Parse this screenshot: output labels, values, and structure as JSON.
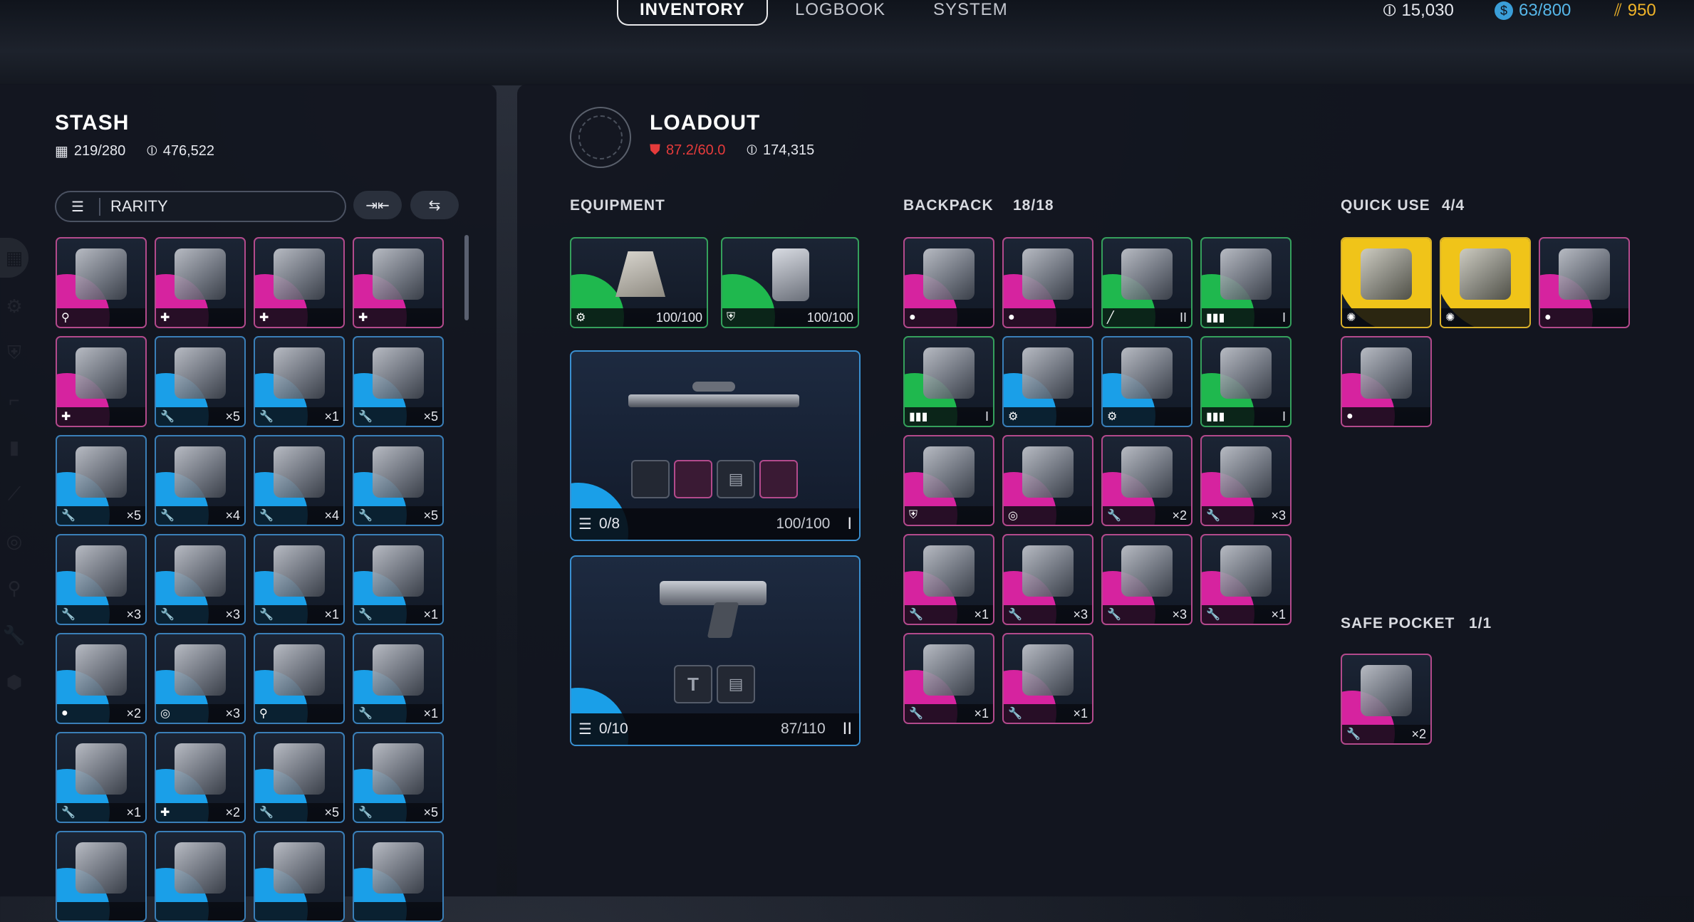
{
  "nav": {
    "tabs": [
      {
        "label": "INVENTORY"
      },
      {
        "label": "LOGBOOK"
      },
      {
        "label": "SYSTEM"
      }
    ],
    "currencies": [
      {
        "icon": "coin-icon",
        "value": "15,030",
        "color": "#ffffff"
      },
      {
        "icon": "token-icon",
        "value": "63/800",
        "color": "#56b6e8"
      },
      {
        "icon": "crown-icon",
        "value": "950",
        "color": "#f0b429"
      }
    ]
  },
  "stash": {
    "title": "STASH",
    "capacity": "219/280",
    "value": "476,522",
    "filter": "RARITY",
    "items": [
      {
        "r": "mag",
        "icon": "key-icon",
        "qty": ""
      },
      {
        "r": "mag",
        "icon": "plus-icon",
        "qty": ""
      },
      {
        "r": "mag",
        "icon": "plus-icon",
        "qty": ""
      },
      {
        "r": "mag",
        "icon": "plus-icon",
        "qty": ""
      },
      {
        "r": "mag",
        "icon": "plus-icon",
        "qty": ""
      },
      {
        "r": "blu",
        "icon": "wrench-icon",
        "qty": "×5"
      },
      {
        "r": "blu",
        "icon": "wrench-icon",
        "qty": "×1"
      },
      {
        "r": "blu",
        "icon": "wrench-icon",
        "qty": "×5"
      },
      {
        "r": "blu",
        "icon": "wrench-icon",
        "qty": "×5"
      },
      {
        "r": "blu",
        "icon": "wrench-icon",
        "qty": "×4"
      },
      {
        "r": "blu",
        "icon": "wrench-icon",
        "qty": "×4"
      },
      {
        "r": "blu",
        "icon": "wrench-icon",
        "qty": "×5"
      },
      {
        "r": "blu",
        "icon": "wrench-icon",
        "qty": "×3"
      },
      {
        "r": "blu",
        "icon": "wrench-icon",
        "qty": "×3"
      },
      {
        "r": "blu",
        "icon": "wrench-icon",
        "qty": "×1"
      },
      {
        "r": "blu",
        "icon": "wrench-icon",
        "qty": "×1"
      },
      {
        "r": "blu",
        "icon": "grenade-icon",
        "qty": "×2"
      },
      {
        "r": "blu",
        "icon": "target-icon",
        "qty": "×3"
      },
      {
        "r": "blu",
        "icon": "key-icon",
        "qty": ""
      },
      {
        "r": "blu",
        "icon": "wrench-icon",
        "qty": "×1"
      },
      {
        "r": "blu",
        "icon": "wrench-icon",
        "qty": "×1"
      },
      {
        "r": "blu",
        "icon": "plus-icon",
        "qty": "×2"
      },
      {
        "r": "blu",
        "icon": "wrench-icon",
        "qty": "×5"
      },
      {
        "r": "blu",
        "icon": "wrench-icon",
        "qty": "×5"
      },
      {
        "r": "blu",
        "icon": "",
        "qty": ""
      },
      {
        "r": "blu",
        "icon": "",
        "qty": ""
      },
      {
        "r": "blu",
        "icon": "",
        "qty": ""
      },
      {
        "r": "blu",
        "icon": "",
        "qty": ""
      }
    ]
  },
  "loadout": {
    "title": "LOADOUT",
    "weight": "87.2/60.0",
    "value": "174,315",
    "equipment_label": "EQUIPMENT",
    "equipment": [
      {
        "r": "grn",
        "icon": "gear-icon",
        "durability": "100/100"
      },
      {
        "r": "grn",
        "icon": "shield-icon",
        "durability": "100/100"
      }
    ],
    "weapons": [
      {
        "ammo": "0/8",
        "durability": "100/100",
        "tier": "I"
      },
      {
        "ammo": "0/10",
        "durability": "87/110",
        "tier": "II"
      }
    ],
    "backpack_label": "BACKPACK",
    "backpack_count": "18/18",
    "backpack": [
      {
        "r": "mag",
        "icon": "grenade-icon",
        "qty": ""
      },
      {
        "r": "mag",
        "icon": "grenade-icon",
        "qty": ""
      },
      {
        "r": "grn",
        "icon": "knife-icon",
        "qty": "II"
      },
      {
        "r": "grn",
        "icon": "ammo-icon",
        "qty": "I"
      },
      {
        "r": "grn",
        "icon": "ammo-icon",
        "qty": "I"
      },
      {
        "r": "blu",
        "icon": "gear-icon",
        "qty": ""
      },
      {
        "r": "blu",
        "icon": "gear-icon",
        "qty": ""
      },
      {
        "r": "grn",
        "icon": "ammo-icon",
        "qty": "I"
      },
      {
        "r": "mag",
        "icon": "shield-icon",
        "qty": ""
      },
      {
        "r": "mag",
        "icon": "target-icon",
        "qty": ""
      },
      {
        "r": "mag",
        "icon": "wrench-icon",
        "qty": "×2"
      },
      {
        "r": "mag",
        "icon": "wrench-icon",
        "qty": "×3"
      },
      {
        "r": "mag",
        "icon": "wrench-icon",
        "qty": "×1"
      },
      {
        "r": "mag",
        "icon": "wrench-icon",
        "qty": "×3"
      },
      {
        "r": "mag",
        "icon": "wrench-icon",
        "qty": "×3"
      },
      {
        "r": "mag",
        "icon": "wrench-icon",
        "qty": "×1"
      },
      {
        "r": "mag",
        "icon": "wrench-icon",
        "qty": "×1"
      },
      {
        "r": "mag",
        "icon": "wrench-icon",
        "qty": "×1"
      }
    ],
    "quick_label": "QUICK USE",
    "quick_count": "4/4",
    "quick": [
      {
        "r": "gld",
        "icon": "radiation-icon",
        "qty": ""
      },
      {
        "r": "gld",
        "icon": "radiation-icon",
        "qty": ""
      },
      {
        "r": "mag",
        "icon": "grenade-icon",
        "qty": ""
      },
      {
        "r": "mag",
        "icon": "grenade-icon",
        "qty": ""
      }
    ],
    "safe_label": "SAFE POCKET",
    "safe_count": "1/1",
    "safe": [
      {
        "r": "mag",
        "icon": "wrench-icon",
        "qty": "×2"
      }
    ]
  },
  "icons": {
    "wrench-icon": "🔧",
    "plus-icon": "✚",
    "key-icon": "⚲",
    "grenade-icon": "●",
    "target-icon": "◎",
    "gear-icon": "⚙",
    "shield-icon": "⛨",
    "ammo-icon": "▮▮▮",
    "knife-icon": "╱",
    "radiation-icon": "✺"
  }
}
